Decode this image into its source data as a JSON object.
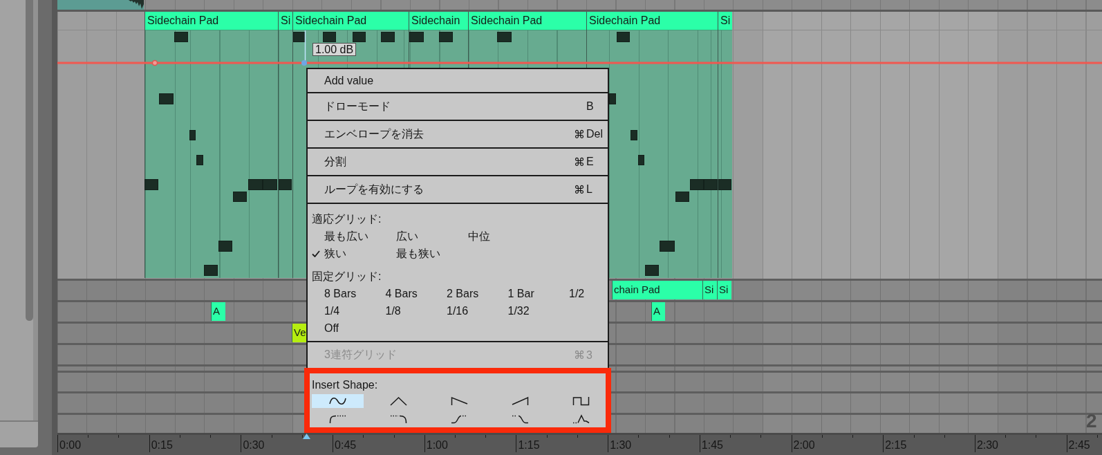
{
  "main_track": {
    "clips": [
      {
        "name": "Sidechain Pad"
      },
      {
        "name": "Si"
      },
      {
        "name": "Sidechain Pad"
      },
      {
        "name": "Sidechain"
      },
      {
        "name": "Sidechain Pad"
      },
      {
        "name": "Sidechain Pad"
      },
      {
        "name": "Si"
      }
    ],
    "automation_value": "1.00 dB"
  },
  "lower_tracks": [
    {
      "clips": [
        {
          "name": "chain Pad",
          "color": "#2bffa8"
        },
        {
          "name": "Si",
          "color": "#2bffa8"
        },
        {
          "name": "Si",
          "color": "#2bffa8"
        }
      ]
    },
    {
      "clips": [
        {
          "name": "A",
          "color": "#2bffa8"
        },
        {
          "name": "A",
          "color": "#2bffa8"
        }
      ]
    },
    {
      "clips": [
        {
          "name": "Ve",
          "color": "#b6ee10"
        }
      ]
    }
  ],
  "ruler": {
    "labels": [
      "0:00",
      "0:15",
      "0:30",
      "0:45",
      "1:00",
      "1:15",
      "1:30",
      "1:45",
      "2:00",
      "2:15",
      "2:30",
      "2:45"
    ]
  },
  "corner_label": "2",
  "context_menu": {
    "commands": [
      {
        "label": "Add value",
        "disabled": false
      },
      {
        "label": "ドローモード",
        "key": "B",
        "disabled": false
      },
      {
        "label": "エンベロープを消去",
        "modifier": "⌘",
        "key": "Del",
        "disabled": false
      },
      {
        "label": "分割",
        "modifier": "⌘",
        "key": "E",
        "disabled": false
      },
      {
        "label": "ループを有効にする",
        "modifier": "⌘",
        "key": "L",
        "disabled": false
      }
    ],
    "adaptive_grid": {
      "title": "適応グリッド:",
      "rows": [
        [
          {
            "label": "最も広い",
            "checked": false
          },
          {
            "label": "広い",
            "checked": false
          },
          {
            "label": "中位",
            "checked": false
          }
        ],
        [
          {
            "label": "狭い",
            "checked": true
          },
          {
            "label": "最も狭い",
            "checked": false
          }
        ]
      ]
    },
    "fixed_grid": {
      "title": "固定グリッド:",
      "rows": [
        [
          {
            "label": "8 Bars",
            "checked": false
          },
          {
            "label": "4 Bars",
            "checked": false
          },
          {
            "label": "2 Bars",
            "checked": false
          },
          {
            "label": "1 Bar",
            "checked": false
          },
          {
            "label": "1/2",
            "checked": false
          }
        ],
        [
          {
            "label": "1/4",
            "checked": false
          },
          {
            "label": "1/8",
            "checked": false
          },
          {
            "label": "1/16",
            "checked": false
          },
          {
            "label": "1/32",
            "checked": false
          }
        ],
        [
          {
            "label": "Off",
            "checked": false
          }
        ]
      ]
    },
    "triplet_grid": {
      "label": "3連符グリッド",
      "modifier": "⌘",
      "key": "3",
      "disabled": true
    },
    "insert_shape": {
      "title": "Insert Shape:",
      "highlighted": true,
      "rows": [
        [
          {
            "kind": "sine",
            "selected": true
          },
          {
            "kind": "triangle",
            "selected": false
          },
          {
            "kind": "ramp_down",
            "selected": false
          },
          {
            "kind": "ramp_up",
            "selected": false
          },
          {
            "kind": "square",
            "selected": false
          }
        ],
        [
          {
            "kind": "curve_rise",
            "selected": false
          },
          {
            "kind": "curve_fall",
            "selected": false
          },
          {
            "kind": "s_rise",
            "selected": false
          },
          {
            "kind": "s_fall",
            "selected": false
          },
          {
            "kind": "peak",
            "selected": false
          }
        ]
      ]
    }
  }
}
